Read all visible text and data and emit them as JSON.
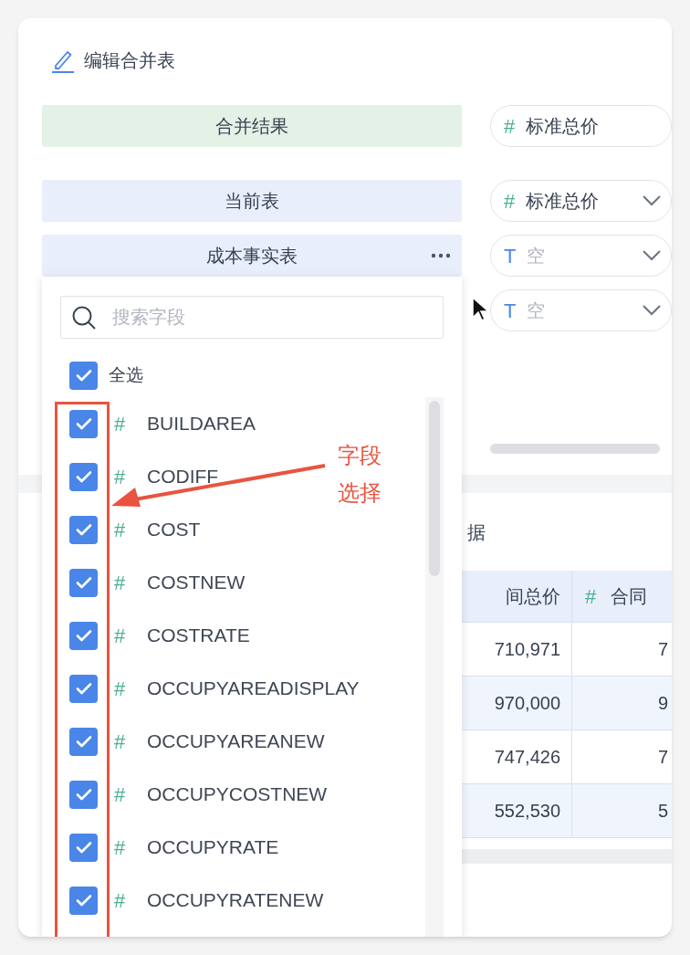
{
  "title": "编辑合并表",
  "bars": [
    {
      "kind": "result",
      "label": "合并结果",
      "has_menu": false
    },
    {
      "kind": "source",
      "label": "当前表",
      "has_menu": false
    },
    {
      "kind": "source",
      "label": "成本事实表",
      "has_menu": true
    }
  ],
  "fields": [
    {
      "kind": "number",
      "type_mark": "#",
      "name": "标准总价",
      "empty": false,
      "has_dropdown": false
    },
    {
      "kind": "number",
      "type_mark": "#",
      "name": "标准总价",
      "empty": false,
      "has_dropdown": true
    },
    {
      "kind": "text",
      "type_mark": "T",
      "name": "空",
      "empty": true,
      "has_dropdown": true
    },
    {
      "kind": "text",
      "type_mark": "T",
      "name": "空",
      "empty": true,
      "has_dropdown": true
    }
  ],
  "data_section": {
    "title": "据",
    "columns": [
      {
        "label": "间总价"
      },
      {
        "type_mark": "#",
        "label": "合同"
      }
    ],
    "rows": [
      [
        "710,971",
        "7"
      ],
      [
        "970,000",
        "9"
      ],
      [
        "747,426",
        "7"
      ],
      [
        "552,530",
        "5"
      ]
    ]
  },
  "field_picker": {
    "search": {
      "placeholder": "搜索字段"
    },
    "select_all": {
      "label": "全选",
      "checked": true
    },
    "items": [
      {
        "type_mark": "#",
        "name": "BUILDAREA",
        "checked": true
      },
      {
        "type_mark": "#",
        "name": "CODIFF",
        "checked": true
      },
      {
        "type_mark": "#",
        "name": "COST",
        "checked": true
      },
      {
        "type_mark": "#",
        "name": "COSTNEW",
        "checked": true
      },
      {
        "type_mark": "#",
        "name": "COSTRATE",
        "checked": true
      },
      {
        "type_mark": "#",
        "name": "OCCUPYAREADISPLAY",
        "checked": true
      },
      {
        "type_mark": "#",
        "name": "OCCUPYAREANEW",
        "checked": true
      },
      {
        "type_mark": "#",
        "name": "OCCUPYCOSTNEW",
        "checked": true
      },
      {
        "type_mark": "#",
        "name": "OCCUPYRATE",
        "checked": true
      },
      {
        "type_mark": "#",
        "name": "OCCUPYRATENEW",
        "checked": true
      }
    ]
  },
  "annotation": {
    "text": "字段选择"
  }
}
